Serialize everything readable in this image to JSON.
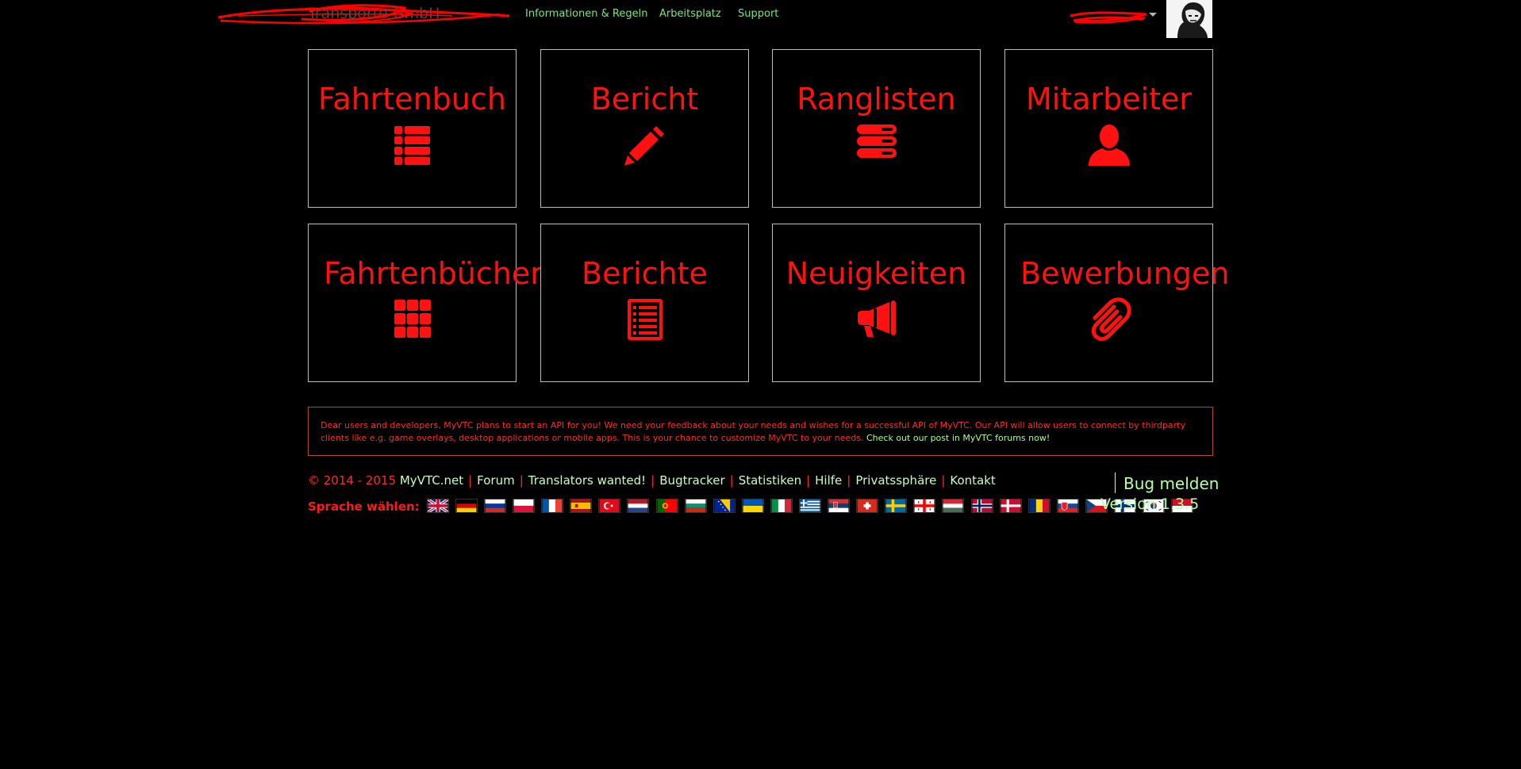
{
  "nav": {
    "brand": "Transporte GmbH",
    "links": [
      {
        "label": "Informationen & Regeln"
      },
      {
        "label": "Arbeitsplatz"
      },
      {
        "label": "Support"
      }
    ]
  },
  "tiles": [
    {
      "label": "Fahrtenbuch",
      "icon": "list-icon"
    },
    {
      "label": "Bericht",
      "icon": "pencil-icon"
    },
    {
      "label": "Ranglisten",
      "icon": "server-stack-icon"
    },
    {
      "label": "Mitarbeiter",
      "icon": "user-icon"
    },
    {
      "label": "Fahrtenbücher",
      "icon": "grid-icon"
    },
    {
      "label": "Berichte",
      "icon": "document-list-icon"
    },
    {
      "label": "Neuigkeiten",
      "icon": "megaphone-icon"
    },
    {
      "label": "Bewerbungen",
      "icon": "paperclip-icon"
    }
  ],
  "notice": {
    "text": "Dear users and developers, MyVTC plans to start an API for you! We need your feedback about your needs and wishes for a successful API of MyVTC. Our API will allow users to connect by thirdparty clients like e.g. game overlays, desktop applications or mobile apps. This is your chance to customize MyVTC to your needs.",
    "link": "Check out our post in MyVTC forums now!"
  },
  "footer": {
    "copyright": "© 2014 - 2015",
    "links": [
      "MyVTC.net",
      "Forum",
      "Translators wanted!",
      "Bugtracker",
      "Statistiken",
      "Hilfe",
      "Privatssphäre",
      "Kontakt"
    ],
    "language_label": "Sprache wählen:",
    "flags": [
      "gb-flag-icon",
      "de-flag-icon",
      "ru-flag-icon",
      "pl-flag-icon",
      "fr-flag-icon",
      "es-flag-icon",
      "tr-flag-icon",
      "nl-flag-icon",
      "pt-flag-icon",
      "bg-flag-icon",
      "ba-flag-icon",
      "ua-flag-icon",
      "it-flag-icon",
      "gr-flag-icon",
      "rs-flag-icon",
      "ch-flag-icon",
      "se-flag-icon",
      "ge-flag-icon",
      "hu-flag-icon",
      "no-flag-icon",
      "dk-flag-icon",
      "ro-flag-icon",
      "sk-flag-icon",
      "cz-flag-icon",
      "fi-flag-icon",
      "kr-flag-icon",
      "id-flag-icon"
    ],
    "bug_report": "Bug melden",
    "version": "Version 1.3.5"
  },
  "colors": {
    "accent_red": "#ff1111",
    "link_green": "#7fe37f",
    "background": "#000000"
  }
}
